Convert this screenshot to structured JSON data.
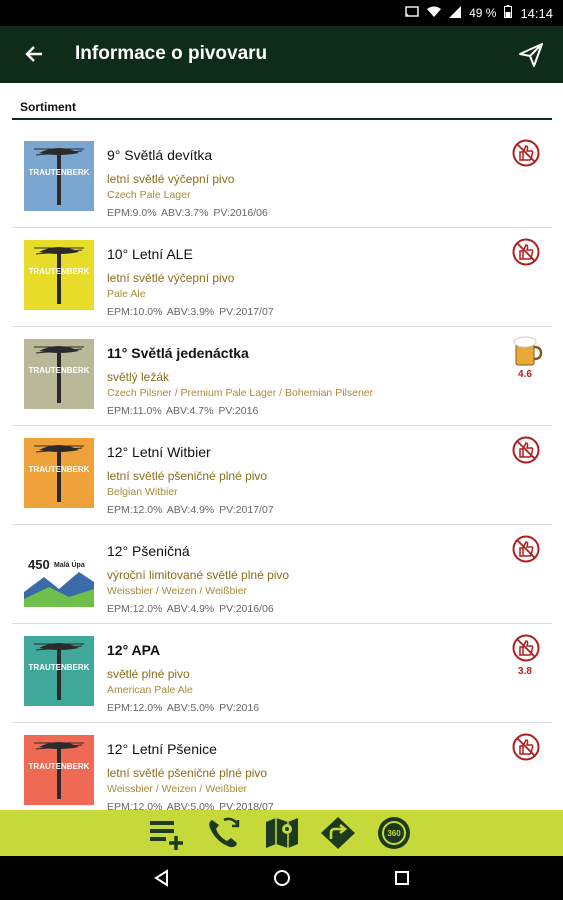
{
  "status": {
    "battery": "49 %",
    "time": "14:14"
  },
  "appbar": {
    "title": "Informace o pivovaru"
  },
  "section": {
    "title": "Sortiment"
  },
  "beers": [
    {
      "name": "9° Světlá devítka",
      "bold": false,
      "desc": "letní světlé výčepní pivo",
      "style": "Czech Pale Lager",
      "meta": "EPM:9.0%  ABV:3.7%  PV:2016/06",
      "color": "#7aa6cf",
      "badge": "thumb",
      "rating": ""
    },
    {
      "name": "10° Letní ALE",
      "bold": false,
      "desc": "letní světlé výčepní pivo",
      "style": "Pale Ale",
      "meta": "EPM:10.0%  ABV:3.9%  PV:2017/07",
      "color": "#e8dc2a",
      "badge": "thumb",
      "rating": ""
    },
    {
      "name": "11° Světlá jedenáctka",
      "bold": true,
      "desc": "světlý ležák",
      "style": "Czech Pilsner / Premium Pale Lager / Bohemian Pilsener",
      "meta": "EPM:11.0%  ABV:4.7%  PV:2016",
      "color": "#b9b99a",
      "badge": "mug",
      "rating": "4.6"
    },
    {
      "name": "12° Letní Witbier",
      "bold": false,
      "desc": "letní světlé pšeničné plné pivo",
      "style": "Belgian Witbier",
      "meta": "EPM:12.0%  ABV:4.9%  PV:2017/07",
      "color": "#f0a23a",
      "badge": "thumb",
      "rating": ""
    },
    {
      "name": "12° Pšeničná",
      "bold": false,
      "desc": "výroční limitované světlé plné pivo",
      "style": "Weissbier / Weizen / Weißbier",
      "meta": "EPM:12.0%  ABV:4.9%  PV:2016/06",
      "color": "#ffffff",
      "badge": "thumb",
      "rating": "",
      "label450": "450",
      "labelText": "Malá Úpa"
    },
    {
      "name": "12° APA",
      "bold": true,
      "desc": "světlé plné pivo",
      "style": "American Pale Ale",
      "meta": "EPM:12.0%  ABV:5.0%  PV:2016",
      "color": "#3fa89a",
      "badge": "thumb",
      "rating": "3.8"
    },
    {
      "name": "12° Letní Pšenice",
      "bold": false,
      "desc": "letní světlé pšeničné plné pivo",
      "style": "Weissbier / Weizen / Weißbier",
      "meta": "EPM:12.0%  ABV:5.0%  PV:2018/07",
      "color": "#ee6a55",
      "badge": "thumb",
      "rating": ""
    }
  ],
  "brand": "TRAUTENBERK",
  "colors": {
    "appbar": "#0e2c17",
    "bottombar": "#c5d93a",
    "accent": "#b11d1d"
  },
  "bottom_icons": [
    "add-list-icon",
    "phone-sync-icon",
    "map-icon",
    "directions-icon",
    "360-icon"
  ],
  "nav_icons": [
    "back-icon",
    "home-icon",
    "recents-icon"
  ]
}
